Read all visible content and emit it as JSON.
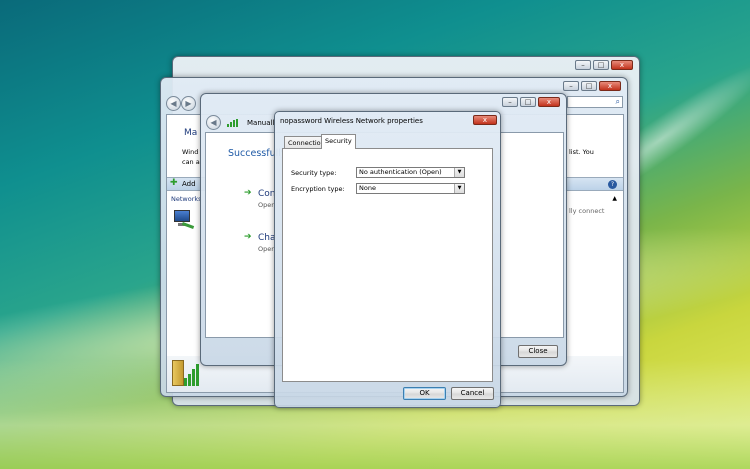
{
  "back_window": {
    "heading_partial": "Ma",
    "desc_partial_1": "Wind",
    "desc_partial_2": "can a",
    "desc_right": "list. You",
    "add_label": "Add",
    "networks_label": "Networks",
    "status_right": "lly connect"
  },
  "wizard": {
    "title_partial": "Manuall",
    "success_partial": "Successfully",
    "option1_title": "Con",
    "option1_sub": "Open",
    "option2_title": "Cha",
    "option2_sub": "Open",
    "close_label": "Close"
  },
  "dialog": {
    "title": "nopassword Wireless Network properties",
    "tabs": [
      {
        "label": "Connection"
      },
      {
        "label": "Security"
      }
    ],
    "security_type_label": "Security type:",
    "security_type_value": "No authentication (Open)",
    "encryption_type_label": "Encryption type:",
    "encryption_type_value": "None",
    "ok_label": "OK",
    "cancel_label": "Cancel",
    "close_glyph": "x"
  },
  "window_glyphs": {
    "minimize": "–",
    "maximize": "□",
    "close": "x"
  },
  "colors": {
    "accent_link": "#1e3a7b",
    "success_text": "#1f5aa6",
    "green_arrow": "#2e9d2e",
    "close_red": "#c2321c"
  }
}
